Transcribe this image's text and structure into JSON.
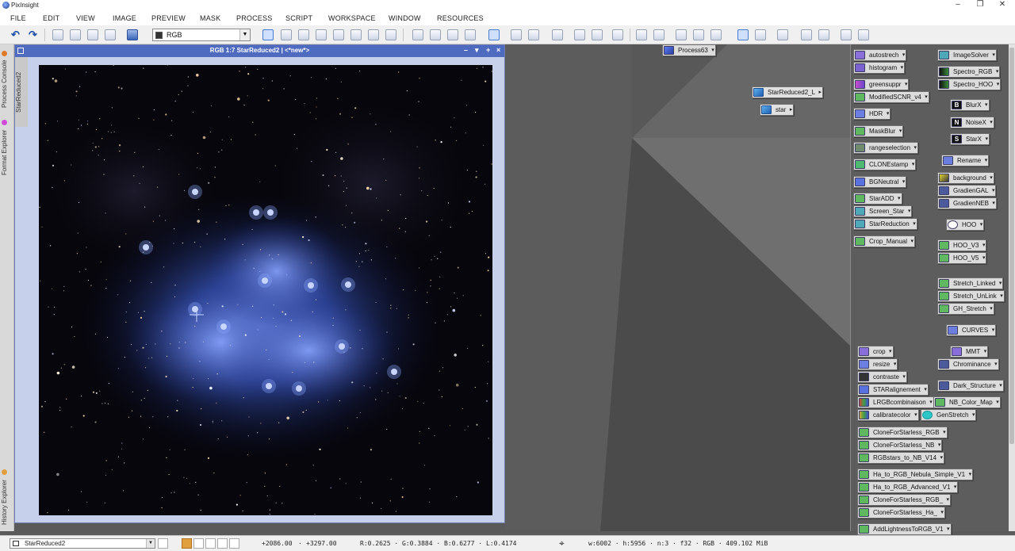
{
  "app": {
    "title": "PixInsight"
  },
  "menu": [
    "FILE",
    "EDIT",
    "VIEW",
    "IMAGE",
    "PREVIEW",
    "MASK",
    "PROCESS",
    "SCRIPT",
    "WORKSPACE",
    "WINDOW",
    "RESOURCES"
  ],
  "toolbar": {
    "rgb_mode": "RGB"
  },
  "sidebar": {
    "tabs": [
      "Process Console",
      "Format Explorer",
      "History Explorer"
    ],
    "thumbnail_tab": "StarReduced2"
  },
  "image_window": {
    "title": "RGB 1:7 StarReduced2 | <*new*>",
    "controls": [
      "–",
      "▾",
      "+",
      "×"
    ]
  },
  "desktop": {
    "icons": [
      "Process63",
      "StarReduced2_L",
      "star"
    ]
  },
  "process_icons": {
    "left_column": [
      "autostrech",
      "histogram",
      "greensuppr",
      "ModifiedSCNR_v4",
      "HDR",
      "MaskBlur",
      "rangeselection",
      "CLONEstamp",
      "BGNeutral",
      "StarADD",
      "Screen_Star",
      "StarReduction",
      "Crop_Manual",
      "crop",
      "resize",
      "contraste",
      "STARalignement",
      "LRGBcombinaison",
      "calibratecolor",
      "CloneForStarless_RGB",
      "CloneForStarless_NB",
      "RGBstars_to_NB_V14",
      "Ha_to_RGB_Nebula_Simple_V1",
      "Ha_to_RGB_Advanced_V1",
      "CloneForStarless_RGB_",
      "CloneForStarless_Ha_",
      "AddLightnessToRGB_V1"
    ],
    "right_column": [
      "ImageSolver",
      "Spectro_RGB",
      "Spectro_HOO",
      "BlurX",
      "NoiseX",
      "StarX",
      "Rename",
      "background",
      "GradienGAL",
      "GradienNEB",
      "HOO",
      "HOO_V3",
      "HOO_V5",
      "Stretch_Linked",
      "Stretch_UnLink",
      "GH_Stretch",
      "CURVES",
      "MMT",
      "Chrominance",
      "Dark_Structure",
      "NB_Color_Map",
      "GenStretch"
    ]
  },
  "statusbar": {
    "view": "StarReduced2",
    "x": "+2086.00",
    "y": "+3297.00",
    "pixel": "R:0.2625 · G:0.3884 · B:0.6277 · L:0.4174",
    "info": "w:6002 · h:5956 · n:3 · f32 · RGB · 409.102 MiB"
  },
  "colors": {
    "window_title": "#4e6bc0",
    "accent_cyan": "#2cc6c6"
  }
}
